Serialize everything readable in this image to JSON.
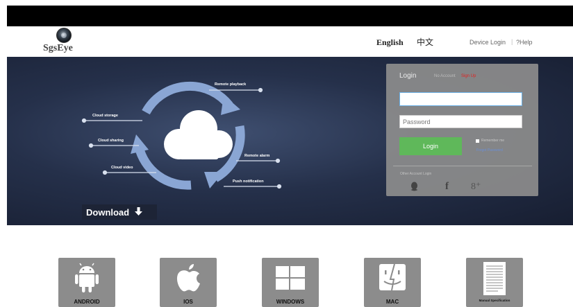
{
  "header": {
    "logo_text": "SgsEye",
    "lang_english": "English",
    "lang_chinese": "中文",
    "device_login": "Device Login",
    "separator": "|",
    "help": "?Help"
  },
  "banner": {
    "features": {
      "remote_playback": "Remote playback",
      "cloud_storage": "Cloud storage",
      "cloud_sharing": "Cloud sharing",
      "cloud_video": "Cloud video",
      "remote_alarm": "Remote alarm",
      "push_notification": "Push notification"
    },
    "download_label": "Download"
  },
  "login": {
    "title": "Login",
    "no_account": "No Account",
    "sign_up": "Sign Up",
    "username_value": "",
    "password_placeholder": "Password",
    "login_button": "Login",
    "remember_me": "Remember me",
    "forgot_password": "Forgot Password",
    "other_account_login": "Other Account Login",
    "social_icons": [
      "qq-icon",
      "facebook-icon",
      "google-plus-icon"
    ],
    "facebook_glyph": "f",
    "google_plus_glyph": "8⁺"
  },
  "platforms": [
    {
      "name": "ANDROID",
      "icon": "android-icon"
    },
    {
      "name": "IOS",
      "icon": "apple-icon"
    },
    {
      "name": "WINDOWS",
      "icon": "windows-icon"
    },
    {
      "name": "MAC",
      "icon": "finder-icon"
    },
    {
      "name": "Manual Specification",
      "icon": "document-icon"
    }
  ],
  "colors": {
    "login_green": "#5fb85a",
    "sign_up_red": "#e02020",
    "banner_dark": "#25304a",
    "cycle_arrows": "#8aa6d4"
  }
}
